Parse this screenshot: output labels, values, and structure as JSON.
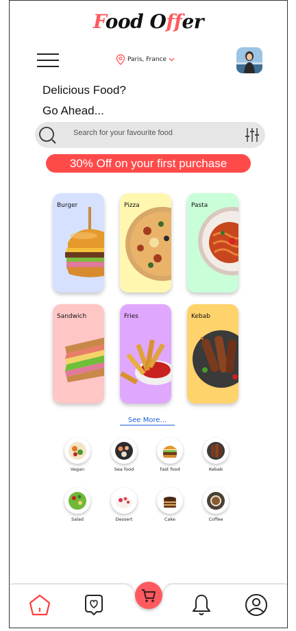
{
  "header": {
    "logo_text_1": "F",
    "logo_text_2": "ood O",
    "logo_text_3": "ff",
    "logo_text_4": "er",
    "location": "Paris, France"
  },
  "greeting": {
    "line1": "Delicious Food?",
    "line2": "Go Ahead..."
  },
  "search": {
    "placeholder": "Search for your favourite food"
  },
  "promo": {
    "text": "30% Off on your first purchase"
  },
  "food_cards": [
    {
      "label": "Burger"
    },
    {
      "label": "Pizza"
    },
    {
      "label": "Pasta"
    },
    {
      "label": "Sandwich"
    },
    {
      "label": "Fries"
    },
    {
      "label": "Kebab"
    }
  ],
  "see_more": "See More...",
  "categories": [
    {
      "label": "Vegan"
    },
    {
      "label": "Sea food"
    },
    {
      "label": "Fast food"
    },
    {
      "label": "Kebab"
    },
    {
      "label": "Salad"
    },
    {
      "label": "Dessert"
    },
    {
      "label": "Cake"
    },
    {
      "label": "Coffee"
    }
  ],
  "colors": {
    "accent": "#ff5a5f",
    "promo": "#ff4a4a",
    "link": "#1a5fd6",
    "burger_bg": "#d6e0ff",
    "pizza_bg": "#fff7b0",
    "pasta_bg": "#c8ffd8",
    "sandwich_bg": "#ffc6c6",
    "fries_bg": "#e0a7ff",
    "kebab_bg": "#ffd36b"
  },
  "nav": {
    "items": [
      "home-icon",
      "favorites-icon",
      "cart-icon",
      "notifications-icon",
      "profile-icon"
    ],
    "active": "home-icon"
  }
}
